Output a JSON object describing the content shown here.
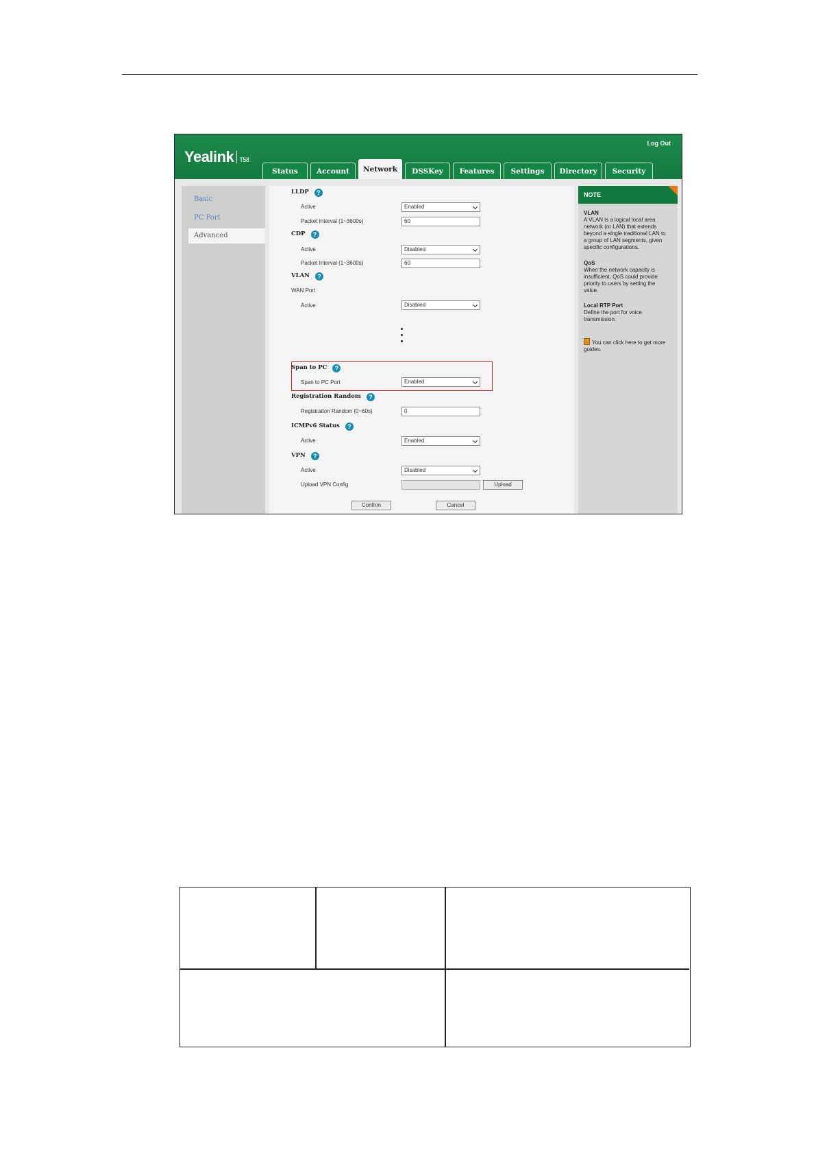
{
  "app": {
    "brand": "Yealink",
    "model": "T58",
    "logout": "Log Out"
  },
  "tabs": [
    "Status",
    "Account",
    "Network",
    "DSSKey",
    "Features",
    "Settings",
    "Directory",
    "Security"
  ],
  "active_tab": "Network",
  "leftnav": [
    "Basic",
    "PC Port",
    "Advanced"
  ],
  "active_nav": "Advanced",
  "sections": {
    "lldp": {
      "title": "LLDP",
      "active_label": "Active",
      "active_value": "Enabled",
      "interval_label": "Packet Interval (1~3600s)",
      "interval_value": "60"
    },
    "cdp": {
      "title": "CDP",
      "active_label": "Active",
      "active_value": "Disabled",
      "interval_label": "Packet Interval (1~3600s)",
      "interval_value": "60"
    },
    "vlan": {
      "title": "VLAN",
      "wan_label": "WAN Port",
      "active_label": "Active",
      "active_value": "Disabled"
    },
    "span": {
      "title": "Span to PC",
      "port_label": "Span to PC Port",
      "port_value": "Enabled"
    },
    "regrandom": {
      "title": "Registration Random",
      "label": "Registration Random (0~60s)",
      "value": "0"
    },
    "icmpv6": {
      "title": "ICMPv6 Status",
      "active_label": "Active",
      "active_value": "Enabled"
    },
    "vpn": {
      "title": "VPN",
      "active_label": "Active",
      "active_value": "Disabled",
      "upload_label": "Upload VPN Config",
      "upload_button": "Upload"
    }
  },
  "buttons": {
    "confirm": "Confirm",
    "cancel": "Cancel"
  },
  "note": {
    "title": "NOTE",
    "items": [
      {
        "title": "VLAN",
        "text": "A VLAN is a logical local area network (or LAN) that extends beyond a single traditional LAN to a group of LAN segments, given specific configurations."
      },
      {
        "title": "QoS",
        "text": "When the network capacity is insufficient, QoS could provide priority to users by setting the value."
      },
      {
        "title": "Local RTP Port",
        "text": "Define the port for voice transmission."
      }
    ],
    "guide": "You can click here to get more guides."
  },
  "colors": {
    "brand_green": "#127a3e",
    "highlight": "#d9232a",
    "help_icon": "#1a8bb0",
    "note_corner": "#e8791a"
  }
}
